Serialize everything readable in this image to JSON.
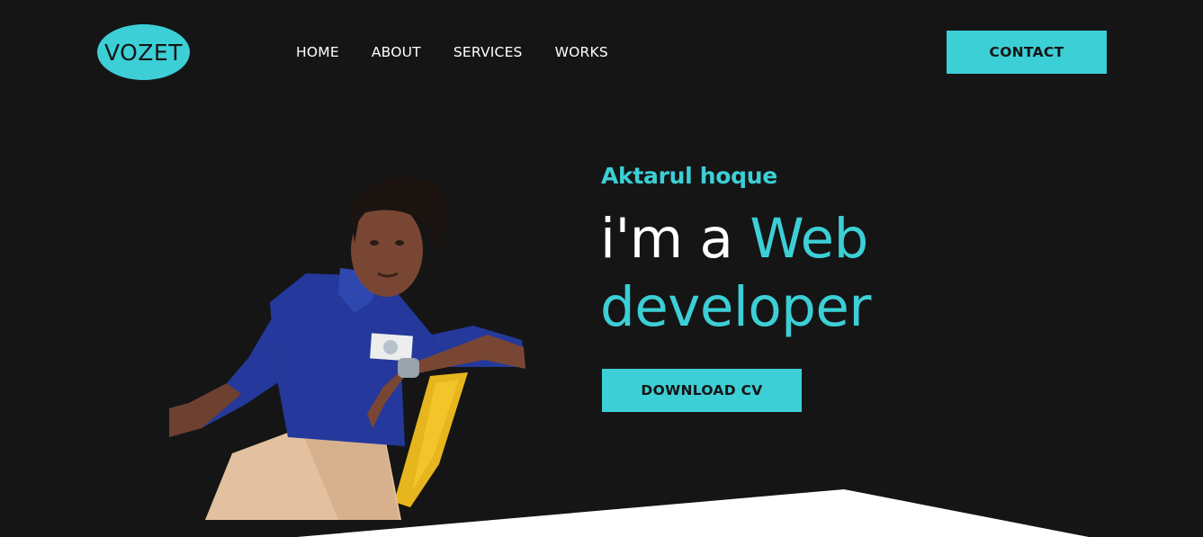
{
  "brand": {
    "logo_text": "VOZET"
  },
  "nav": {
    "items": [
      {
        "label": "HOME"
      },
      {
        "label": "ABOUT"
      },
      {
        "label": "SERVICES"
      },
      {
        "label": "WORKS"
      }
    ]
  },
  "header": {
    "contact_label": "CONTACT"
  },
  "hero": {
    "name": "Aktarul hoque",
    "title_lead": "i'm a",
    "title_accent_1": "Web",
    "title_accent_2": "developer",
    "download_label": "DOWNLOAD CV"
  },
  "colors": {
    "background": "#151515",
    "accent": "#3ccfd6",
    "text": "#ffffff"
  }
}
